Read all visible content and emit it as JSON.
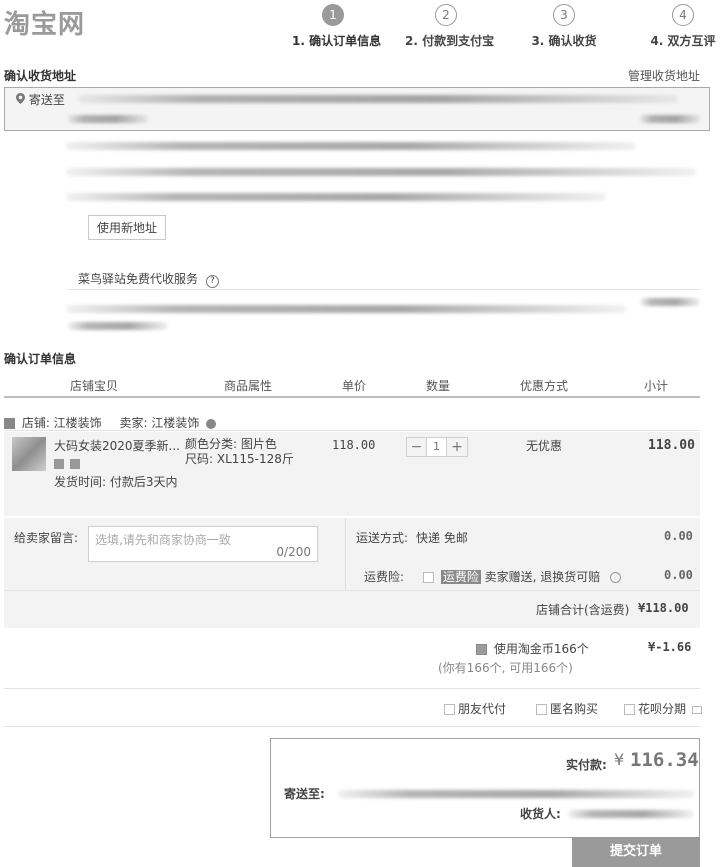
{
  "logo": "淘宝网",
  "steps": [
    {
      "num": "1",
      "label": "1. 确认订单信息"
    },
    {
      "num": "2",
      "label": "2. 付款到支付宝"
    },
    {
      "num": "3",
      "label": "3. 确认收货"
    },
    {
      "num": "4",
      "label": "4. 双方互评"
    }
  ],
  "address": {
    "title": "确认收货地址",
    "manage_link": "管理收货地址",
    "ship_to": "寄送至",
    "new_address_button": "使用新地址",
    "cainiao_service": "菜鸟驿站免费代收服务",
    "help_icon": "?"
  },
  "order": {
    "title": "确认订单信息",
    "columns": [
      "店铺宝贝",
      "商品属性",
      "单价",
      "数量",
      "优惠方式",
      "小计"
    ],
    "shop_label": "店铺: 江楼装饰",
    "seller_label": "卖家: 江楼装饰",
    "item": {
      "name": "大码女装2020夏季新...",
      "attr_color": "颜色分类: 图片色",
      "attr_size": "尺码: XL115-128斤",
      "ship_time": "发货时间: 付款后3天内",
      "price": "118.00",
      "quantity": "1",
      "discount": "无优惠",
      "subtotal": "118.00"
    }
  },
  "message": {
    "label": "给卖家留言:",
    "placeholder": "选填,请先和商家协商一致",
    "counter": "0/200"
  },
  "shipping": {
    "method_label": "运送方式:",
    "method_value": "快递 免邮",
    "method_price": "0.00",
    "insurance_label": "运费险:",
    "insurance_badge": "运费险",
    "insurance_text": "卖家赠送, 退换货可赔",
    "insurance_price": "0.00",
    "shop_total_label": "店铺合计(含运费)",
    "shop_total_value": "¥118.00"
  },
  "coins": {
    "label": "使用淘金币166个",
    "value": "¥-1.66",
    "note": "(你有166个, 可用166个)"
  },
  "options": {
    "friend_pay": "朋友代付",
    "anonymous": "匿名购买",
    "huabei": "花呗分期"
  },
  "summary": {
    "paid_label": "实付款:",
    "currency": "¥",
    "paid_value": "116.34",
    "ship_to_label": "寄送至:",
    "receiver_label": "收货人:"
  },
  "submit_button": "提交订单"
}
